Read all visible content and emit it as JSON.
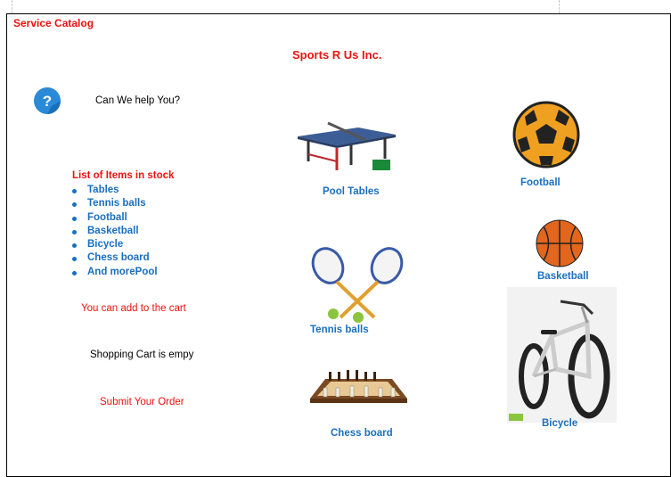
{
  "window_title": "Service Catalog",
  "company_name": "Sports R Us Inc.",
  "help": {
    "icon": "question-circle-icon",
    "label": "Can We help You?"
  },
  "stock": {
    "heading": "List of Items in stock",
    "items": [
      "Tables",
      "Tennis balls",
      "Football",
      "Basketball",
      "Bicycle",
      "Chess board",
      "And morePool"
    ]
  },
  "add_to_cart_label": "You can add to the cart",
  "cart_status": "Shopping Cart is  empy",
  "submit_label": "Submit Your Order",
  "products": {
    "pool_tables": "Pool Tables",
    "football": "Football",
    "basketball": "Basketball",
    "tennis_balls": "Tennis balls",
    "bicycle": "Bicycle",
    "chess_board": "Chess board"
  },
  "colors": {
    "title_red": "#ee1111",
    "link_blue": "#1a6fc0",
    "help_icon_blue": "#2a8ad8"
  }
}
